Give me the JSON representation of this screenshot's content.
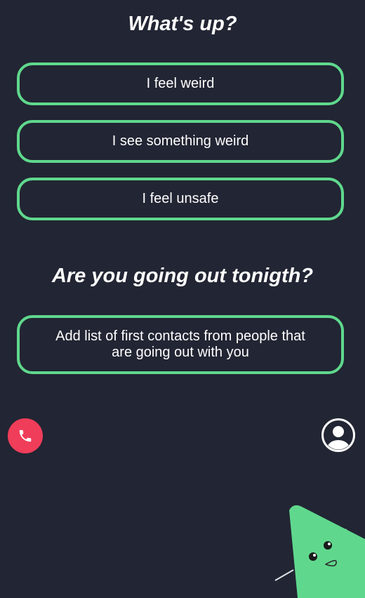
{
  "section_1": {
    "title": "What's up?",
    "options": [
      "I feel weird",
      "I see something weird",
      "I feel unsafe"
    ]
  },
  "section_2": {
    "title": "Are you going out tonigth?",
    "option": "Add list of first contacts from people that are going out with you"
  },
  "icons": {
    "call": "phone-icon",
    "profile": "user-profile-icon",
    "mascot": "triangle-mascot-icon"
  },
  "colors": {
    "background": "#222533",
    "accent": "#5fd88d",
    "call": "#ef3d5a",
    "text": "#ffffff"
  }
}
